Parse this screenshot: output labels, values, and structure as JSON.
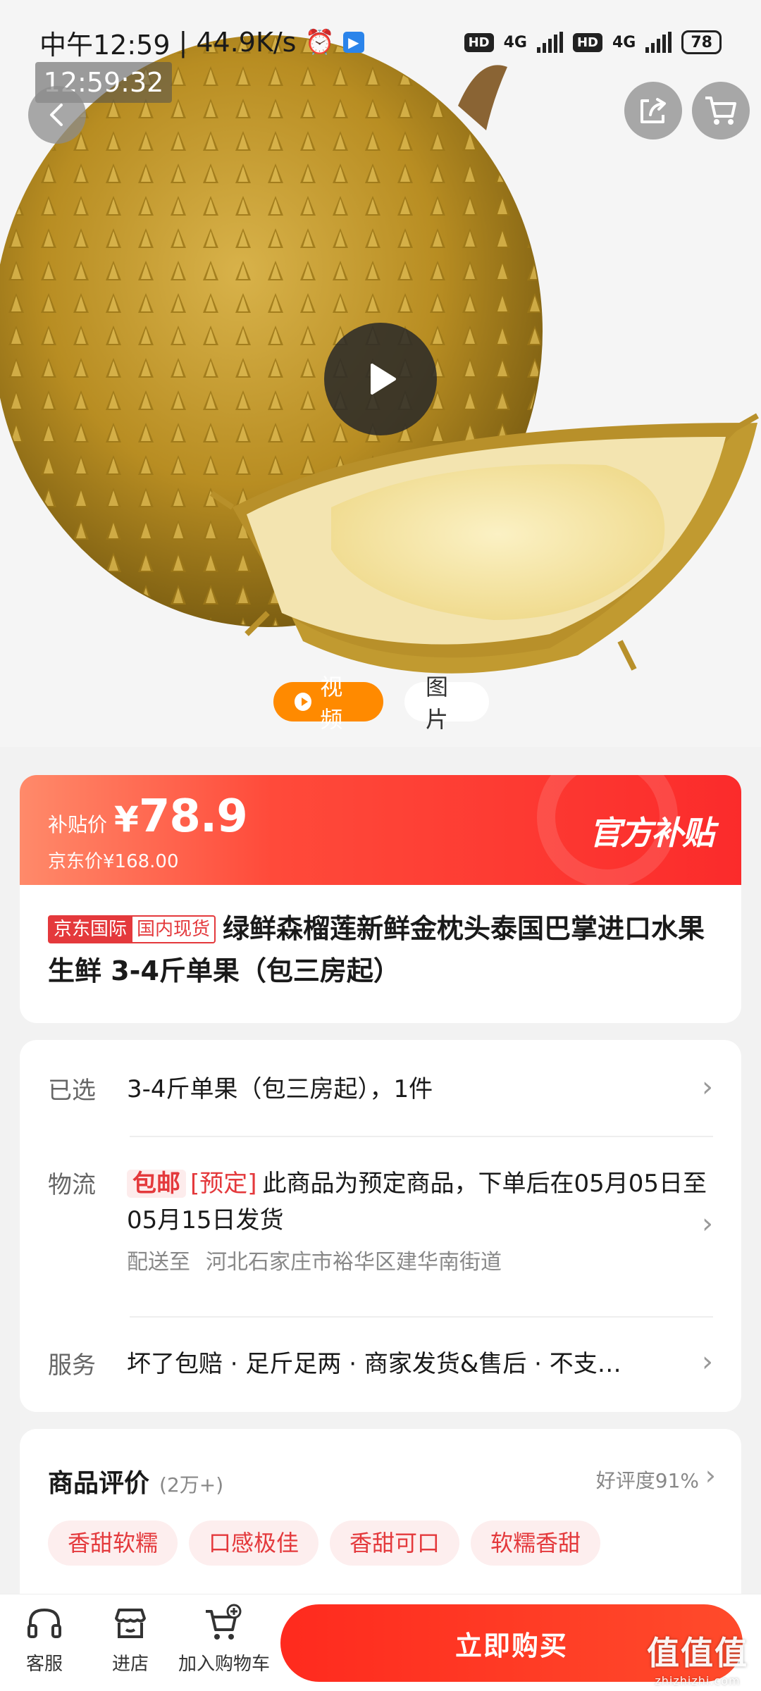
{
  "status_bar": {
    "time": "中午12:59",
    "net_speed": "44.9K/s",
    "hd_1": "HD",
    "net_1": "4G",
    "hd_2": "HD",
    "net_2": "4G",
    "battery": "78"
  },
  "overlay": {
    "clock": "12:59:32"
  },
  "media_tabs": {
    "video_label": "视频",
    "photo_label": "图片",
    "active": "video"
  },
  "price": {
    "label": "补贴价",
    "currency": "¥",
    "value": "78.9",
    "original": "京东价¥168.00",
    "official_tag": "官方补贴"
  },
  "product": {
    "badge_jd": "京东国际",
    "badge_stock": "国内现货",
    "title": "绿鲜森榴莲新鲜金枕头泰国巴掌进口水果生鲜 3-4斤单果（包三房起）"
  },
  "info": {
    "selected_label": "已选",
    "selected_value": "3-4斤单果（包三房起），1件",
    "logistics_label": "物流",
    "free_shipping": "包邮",
    "presale": "[预定]",
    "logistics_text": "此商品为预定商品，下单后在05月05日至05月15日发货",
    "ship_to_label": "配送至",
    "address": "河北石家庄市裕华区建华南街道",
    "service_label": "服务",
    "service_text": "坏了包赔 · 足斤足两 · 商家发货&售后 · 不支…"
  },
  "reviews": {
    "title": "商品评价",
    "count": "(2万+)",
    "rating": "好评度91%",
    "tags": [
      "香甜软糯",
      "口感极佳",
      "香甜可口",
      "软糯香甜"
    ]
  },
  "bottom_bar": {
    "service_label": "客服",
    "store_label": "进店",
    "cart_label": "加入购物车",
    "buy_label": "立即购买"
  },
  "watermark": {
    "main": "值值值",
    "sub": "zhizhizhi.com"
  },
  "colors": {
    "accent": "#e4393c",
    "video_tab": "#ff8a00",
    "buy_button": "#ff2a1e"
  }
}
